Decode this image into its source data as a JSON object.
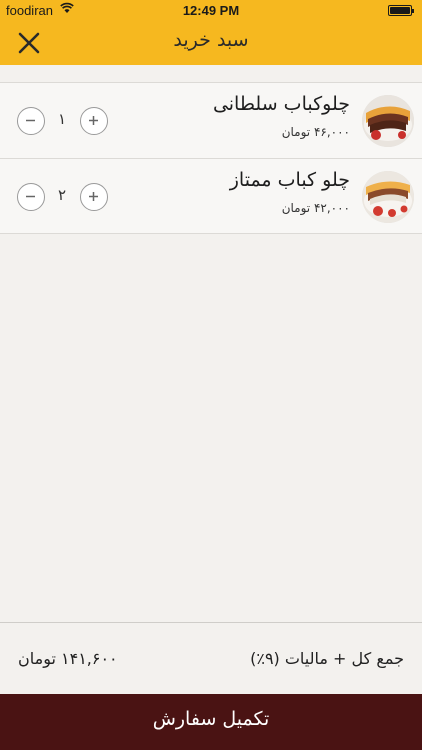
{
  "status_bar": {
    "carrier": "foodiran",
    "time": "12:49 PM"
  },
  "header": {
    "title": "سبد خرید",
    "close_icon": "close-x-icon",
    "background_color": "#f6b81f"
  },
  "cart": {
    "items": [
      {
        "name": "چلوکباب سلطانی",
        "price": "۴۶,۰۰۰ تومان",
        "quantity": "۱",
        "image": "kebab-dish-photo"
      },
      {
        "name": "چلو کباب ممتاز",
        "price": "۴۲,۰۰۰ تومان",
        "quantity": "۲",
        "image": "kebab-dish-photo"
      }
    ]
  },
  "total": {
    "label": "جمع کل + مالیات (۹٪)",
    "value": "۱۴۱,۶۰۰ تومان"
  },
  "checkout": {
    "label": "تکمیل سفارش",
    "background_color": "#4a1313"
  }
}
